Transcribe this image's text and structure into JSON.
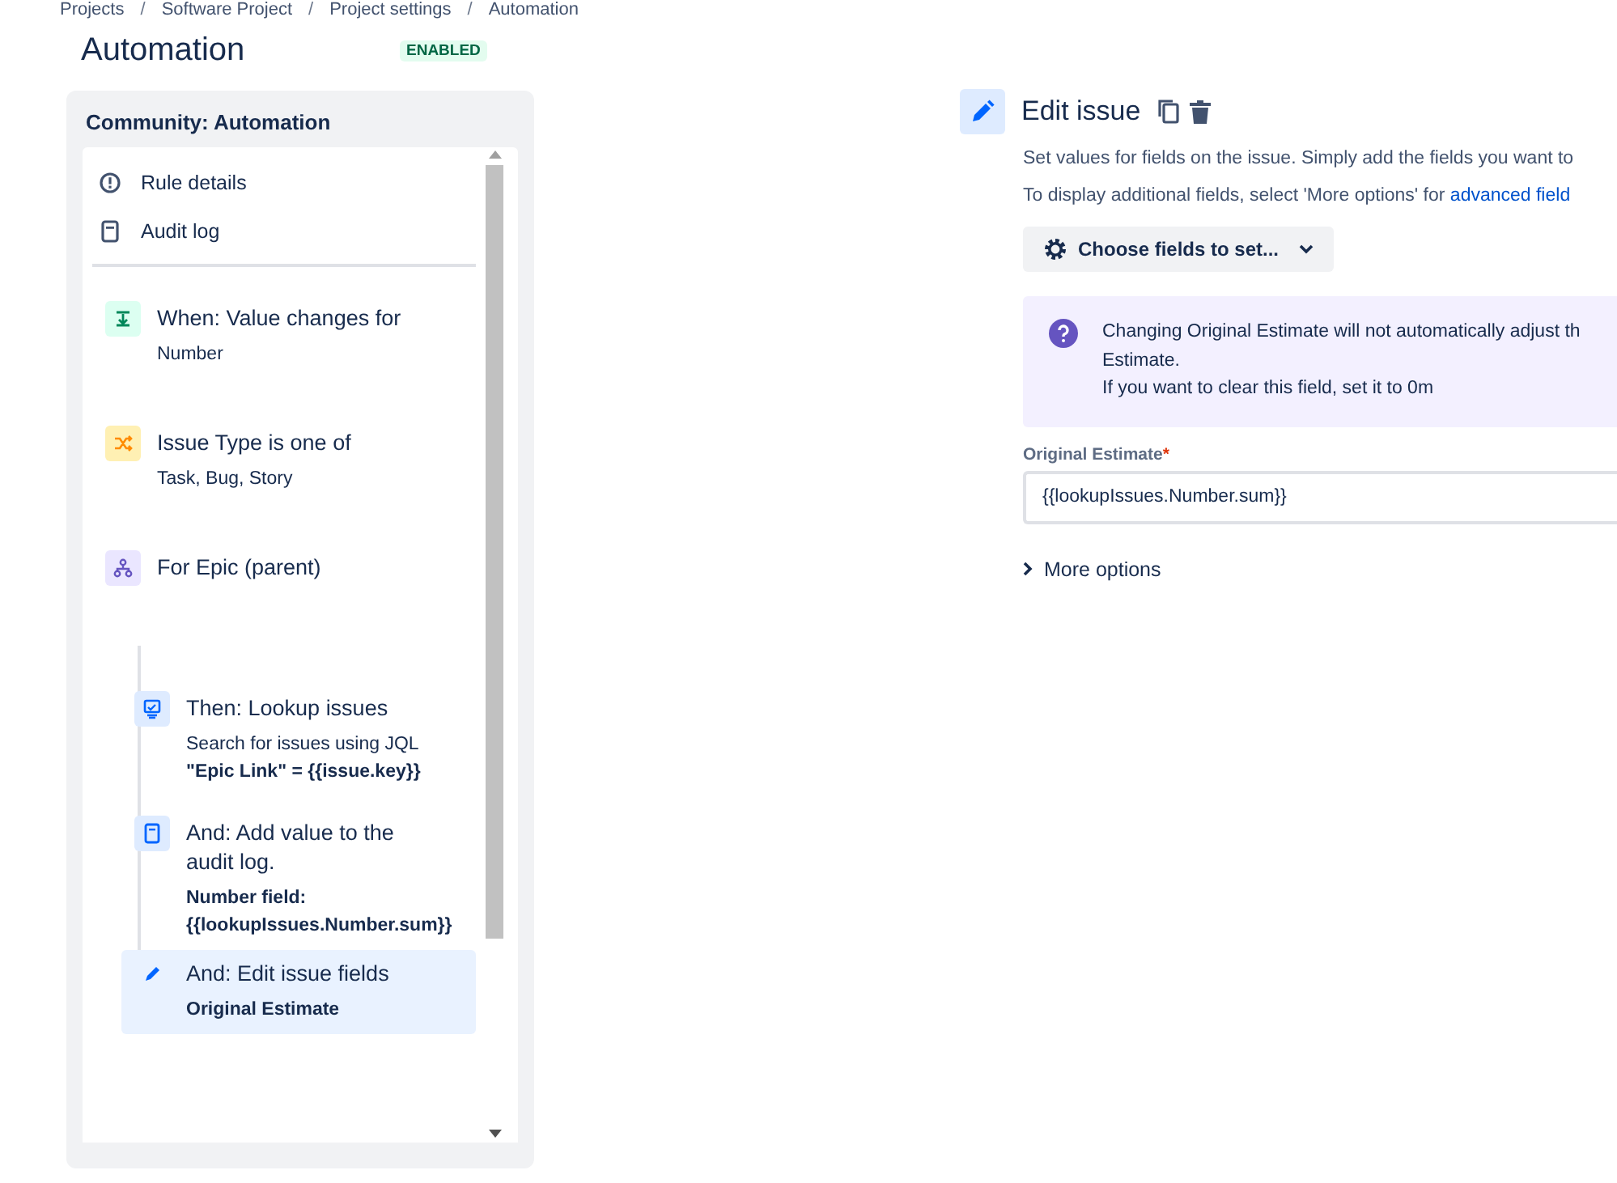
{
  "breadcrumbs": [
    {
      "kind": "link",
      "text": "Projects"
    },
    {
      "kind": "separator",
      "text": "/"
    },
    {
      "kind": "link",
      "text": "Software Project"
    },
    {
      "kind": "separator",
      "text": "/"
    },
    {
      "kind": "link",
      "text": "Project settings"
    },
    {
      "kind": "separator",
      "text": "/"
    },
    {
      "kind": "link",
      "text": "Automation"
    }
  ],
  "page": {
    "title": "Automation",
    "status": "ENABLED"
  },
  "rule_panel": {
    "title": "Community: Automation",
    "links": [
      {
        "kind": "info",
        "label": "Rule details"
      },
      {
        "kind": "log",
        "label": "Audit log"
      }
    ],
    "steps": [
      {
        "kind": "trigger",
        "title": "When: Value changes for",
        "detail": "Number",
        "selected": false
      },
      {
        "kind": "condition",
        "title": "Issue Type is one of",
        "detail": "Task, Bug, Story",
        "selected": false
      },
      {
        "kind": "branch",
        "title": "For Epic (parent)",
        "selected": false,
        "children": [
          {
            "kind": "lookup",
            "title": "Then: Lookup issues",
            "detail": "Search for issues using JQL\n**\"Epic Link\" = {{issue.key}}**",
            "selected": false
          },
          {
            "kind": "log",
            "title": "And: Add value to the audit log.",
            "detail": "**Number field: {{lookupIssues.Number.sum}}**",
            "selected": false
          },
          {
            "kind": "edit",
            "title": "And: Edit issue fields",
            "detail": "**Original Estimate**",
            "selected": true
          }
        ]
      }
    ]
  },
  "editor": {
    "title": "Edit issue",
    "description": "Set values for fields on the issue. Simply add the fields you want to",
    "hint": "To display additional fields, select 'More options' for",
    "hint_link": "advanced field",
    "choose_button": "Choose fields to set...",
    "info": [
      "Changing Original Estimate will not automatically adjust th",
      "Estimate.",
      "If you want to clear this field, set it to 0m"
    ],
    "field": {
      "label": "Original Estimate",
      "required_mark": "*",
      "value": "{{lookupIssues.Number.sum}}"
    },
    "more_options": "More options"
  }
}
